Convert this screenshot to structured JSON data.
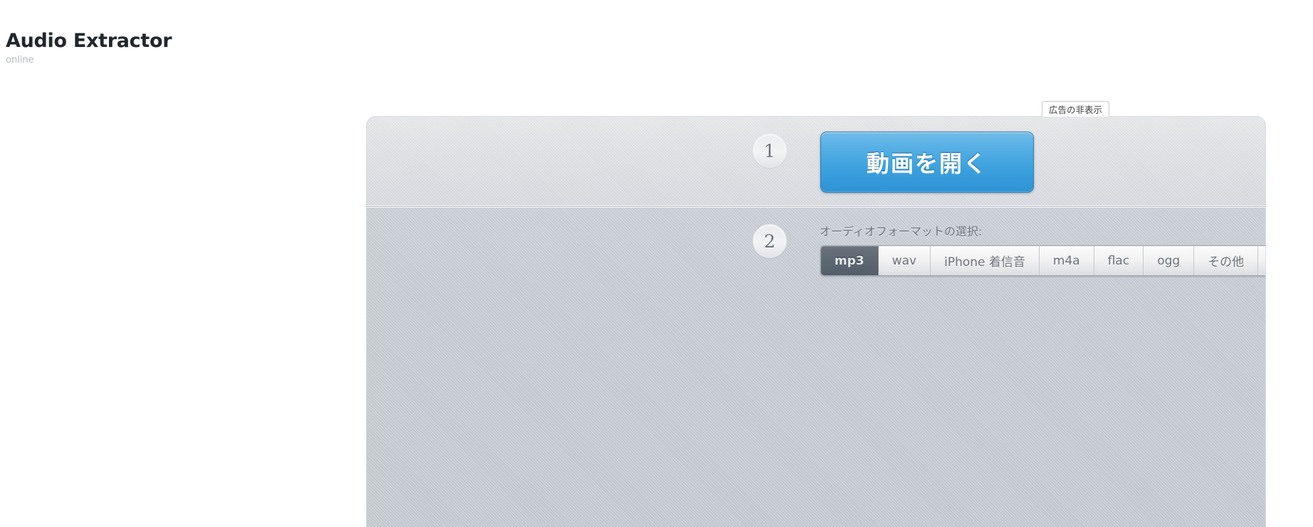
{
  "header": {
    "title": "Audio Extractor",
    "subtitle": "online"
  },
  "ads": {
    "hide_label": "広告の非表示"
  },
  "panel": {
    "steps": [
      {
        "number": "1",
        "action_label": "動画を開く"
      },
      {
        "number": "2",
        "format_label": "オーディオフォーマットの選択:",
        "formats": [
          {
            "label": "mp3",
            "selected": true
          },
          {
            "label": "wav",
            "selected": false
          },
          {
            "label": "iPhone 着信音",
            "selected": false
          },
          {
            "label": "m4a",
            "selected": false
          },
          {
            "label": "flac",
            "selected": false
          },
          {
            "label": "ogg",
            "selected": false
          },
          {
            "label": "その他",
            "selected": false
          }
        ],
        "stepper_up": "▲",
        "stepper_down": "▼"
      }
    ]
  },
  "colors": {
    "accent_blue": "#3ba0dd",
    "selected_tab": "#5e6872",
    "panel_top": "#dcdee2",
    "panel_bottom": "#c4cad1",
    "title_text": "#22272b",
    "subtitle_text": "#b4b8bb"
  }
}
